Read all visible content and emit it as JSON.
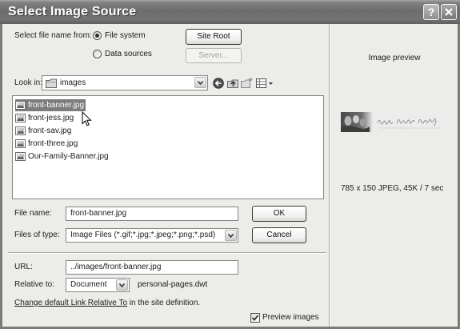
{
  "window": {
    "title": "Select Image Source",
    "help_label": "?"
  },
  "colors": {
    "dialog_background": "#ecece9",
    "selection": "#7c7c7c"
  },
  "source": {
    "label": "Select file name from:",
    "options": [
      {
        "label": "File system",
        "selected": true
      },
      {
        "label": "Data sources",
        "selected": false
      }
    ],
    "site_root_label": "Site Root",
    "server": {
      "label": "Server...",
      "enabled": false
    }
  },
  "browser": {
    "look_in_label": "Look in:",
    "folder": "images",
    "files": [
      "front-banner.jpg",
      "front-jess.jpg",
      "front-sav.jpg",
      "front-three.jpg",
      "Our-Family-Banner.jpg"
    ],
    "selected_file": "front-banner.jpg"
  },
  "file_name": {
    "label": "File name:",
    "value": "front-banner.jpg"
  },
  "files_of_type": {
    "label": "Files of type:",
    "value": "Image Files (*.gif;*.jpg;*.jpeg;*.png;*.psd)"
  },
  "buttons": {
    "ok": "OK",
    "cancel": "Cancel"
  },
  "url": {
    "label": "URL:",
    "value": "../images/front-banner.jpg"
  },
  "relative_to": {
    "label": "Relative to:",
    "value": "Document",
    "document": "personal-pages.dwt"
  },
  "site_note": {
    "link_label": "Change default Link Relative To",
    "suffix": " in the site definition."
  },
  "preview_images": {
    "label": "Preview images",
    "checked": true
  },
  "preview": {
    "heading": "Image preview",
    "info": "785 x 150 JPEG, 45K / 7 sec"
  },
  "icons": {
    "close": "close-icon",
    "folder": "folder-icon",
    "back": "back-arrow-icon",
    "up": "up-folder-icon",
    "new_folder": "new-folder-icon",
    "view": "view-menu-icon",
    "file": "jpg-file-icon",
    "dropdown": "chevron-down-icon",
    "check": "checkmark-icon",
    "cursor": "mouse-cursor"
  }
}
